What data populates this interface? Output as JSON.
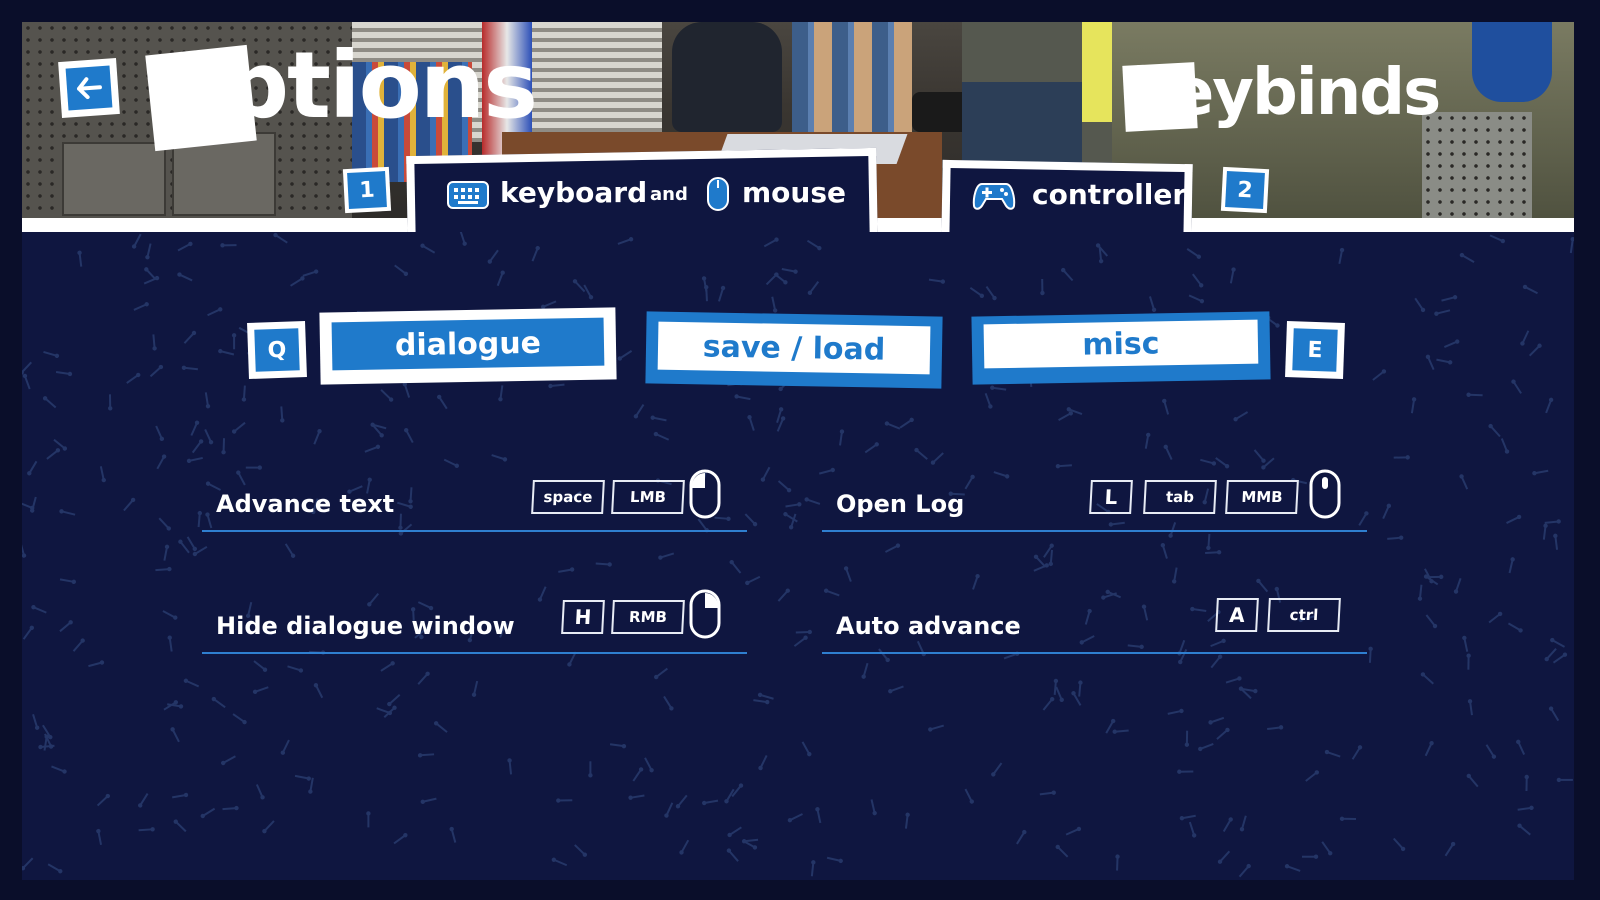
{
  "header": {
    "title": "options",
    "subtitle": "keybinds",
    "back_icon": "arrow-left-icon"
  },
  "input_tabs": [
    {
      "badge": "1",
      "label_left": "keyboard",
      "connector": "and",
      "label_right": "mouse",
      "icons": [
        "keyboard-icon",
        "mouse-icon"
      ],
      "active": true
    },
    {
      "label": "controller",
      "badge": "2",
      "icon": "gamepad-icon",
      "active": false
    }
  ],
  "category_tabs": {
    "prev_key": "Q",
    "next_key": "E",
    "items": [
      {
        "label": "dialogue",
        "active": true
      },
      {
        "label": "save / load",
        "active": false
      },
      {
        "label": "misc",
        "active": false
      }
    ]
  },
  "bindings": [
    {
      "action": "Advance text",
      "keys": [
        "space",
        "LMB"
      ],
      "mouse": "left-click-icon"
    },
    {
      "action": "Open Log",
      "keys": [
        "L",
        "tab",
        "MMB"
      ],
      "mouse": "middle-click-icon"
    },
    {
      "action": "Hide dialogue window",
      "keys": [
        "H",
        "RMB"
      ],
      "mouse": "right-click-icon"
    },
    {
      "action": "Auto advance",
      "keys": [
        "A",
        "ctrl"
      ],
      "mouse": null
    }
  ],
  "colors": {
    "accent": "#1f7acb",
    "background": "#0f1640",
    "text": "#ffffff",
    "row_line": "#2f7fd0"
  }
}
